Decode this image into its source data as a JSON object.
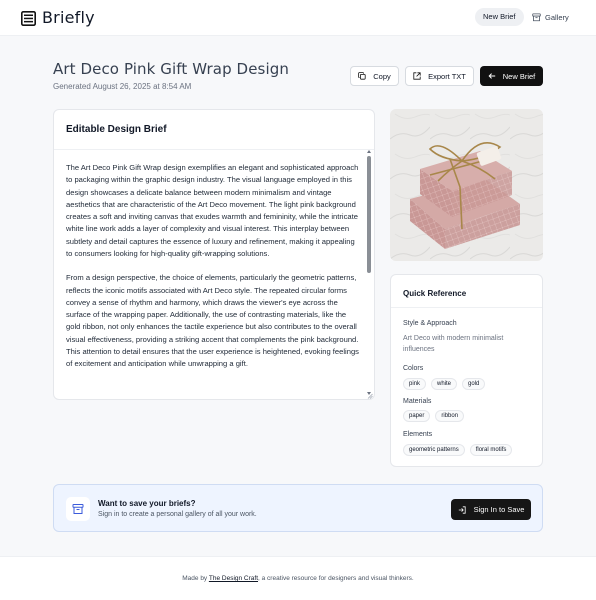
{
  "app": {
    "name": "Briefly"
  },
  "nav": {
    "new_brief": "New Brief",
    "gallery": "Gallery"
  },
  "header": {
    "title": "Art Deco Pink Gift Wrap Design",
    "generated": "Generated August 26, 2025 at 8:54 AM"
  },
  "actions": {
    "copy": "Copy",
    "export": "Export TXT",
    "new_brief": "New Brief"
  },
  "editor": {
    "heading": "Editable Design Brief",
    "paragraphs": [
      "The Art Deco Pink Gift Wrap design exemplifies an elegant and sophisticated approach to packaging within the graphic design industry. The visual language employed in this design showcases a delicate balance between modern minimalism and vintage aesthetics that are characteristic of the Art Deco movement. The light pink background creates a soft and inviting canvas that exudes warmth and femininity, while the intricate white line work adds a layer of complexity and visual interest. This interplay between subtlety and detail captures the essence of luxury and refinement, making it appealing to consumers looking for high-quality gift-wrapping solutions.",
      "From a design perspective, the choice of elements, particularly the geometric patterns, reflects the iconic motifs associated with Art Deco style. The repeated circular forms convey a sense of rhythm and harmony, which draws the viewer's eye across the surface of the wrapping paper. Additionally, the use of contrasting materials, like the gold ribbon, not only enhances the tactile experience but also contributes to the overall visual effectiveness, providing a striking accent that complements the pink background. This attention to detail ensures that the user experience is heightened, evoking feelings of excitement and anticipation while unwrapping a gift."
    ]
  },
  "reference": {
    "heading": "Quick Reference",
    "style_label": "Style & Approach",
    "style_text": "Art Deco with modern minimalist influences",
    "colors_label": "Colors",
    "colors": [
      "pink",
      "white",
      "gold"
    ],
    "materials_label": "Materials",
    "materials": [
      "paper",
      "ribbon"
    ],
    "elements_label": "Elements",
    "elements": [
      "geometric patterns",
      "floral motifs"
    ]
  },
  "banner": {
    "title": "Want to save your briefs?",
    "subtitle": "Sign in to create a personal gallery of all your work.",
    "button": "Sign In to Save"
  },
  "footer": {
    "prefix": "Made by ",
    "link": "The Design Craft",
    "suffix": ", a creative resource for designers and visual thinkers."
  },
  "icons": {
    "logo": "newspaper-icon",
    "gallery": "archive-icon",
    "copy": "copy-icon",
    "export": "export-icon",
    "new_brief": "arrow-left-icon",
    "banner": "archive-icon",
    "signin": "sign-in-icon"
  },
  "colors": {
    "accent": "#111111",
    "banner_bg": "#eef4ff",
    "banner_border": "#cfdcf3",
    "page_bg": "#f7f8fa"
  }
}
